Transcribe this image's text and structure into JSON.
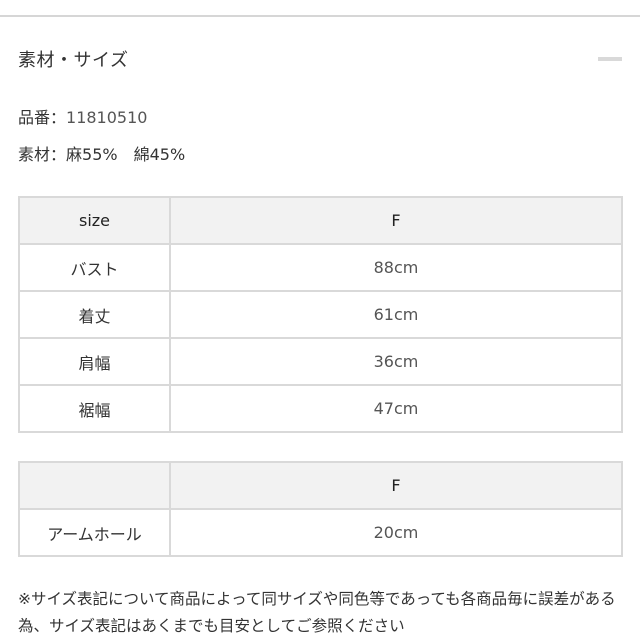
{
  "section": {
    "title": "素材・サイズ",
    "collapse_icon": "minus-icon"
  },
  "info": {
    "product_number_label": "品番：",
    "product_number": "11810510",
    "material_label": "素材：",
    "material_value": "麻55%　綿45%"
  },
  "size_table": {
    "header": [
      "size",
      "F"
    ],
    "rows": [
      {
        "label": "バスト",
        "value": "88cm"
      },
      {
        "label": "着丈",
        "value": "61cm"
      },
      {
        "label": "肩幅",
        "value": "36cm"
      },
      {
        "label": "裾幅",
        "value": "47cm"
      }
    ]
  },
  "arm_table": {
    "header": [
      "",
      "F"
    ],
    "rows": [
      {
        "label": "アームホール",
        "value": "20cm"
      }
    ]
  },
  "note": "※サイズ表記について商品によって同サイズや同色等であっても各商品毎に誤差がある為、サイズ表記はあくまでも目安としてご参照ください"
}
